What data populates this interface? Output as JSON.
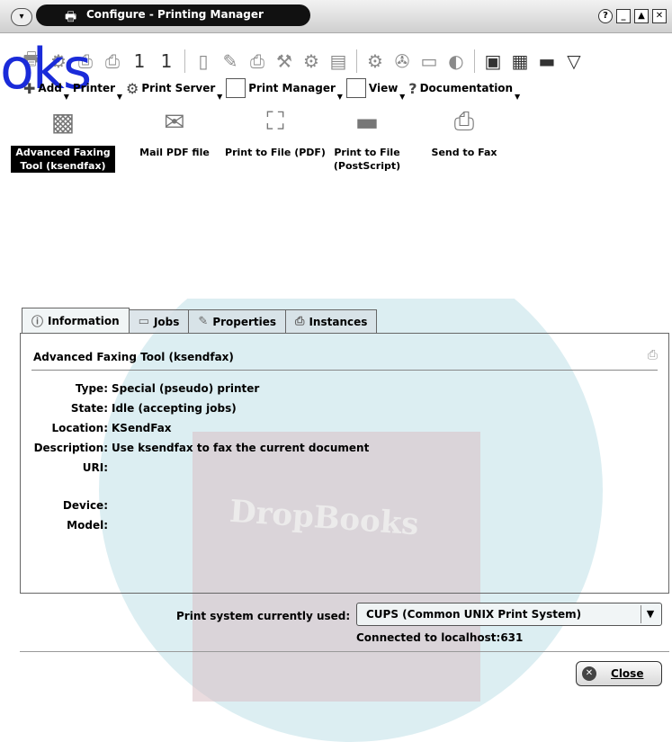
{
  "window": {
    "title": "Configure - Printing Manager",
    "buttons": [
      "?",
      "_",
      "▲",
      "✕"
    ]
  },
  "toolbar_icons": [
    {
      "name": "add-printer-icon",
      "glyph": "🖶",
      "dark": false
    },
    {
      "name": "add-special-icon",
      "glyph": "⚙",
      "dark": false
    },
    {
      "name": "printer-gray-1-icon",
      "glyph": "⎙",
      "dark": false
    },
    {
      "name": "printer-gray-2-icon",
      "glyph": "⎙",
      "dark": false
    },
    {
      "name": "set-default-icon",
      "glyph": "1",
      "dark": true
    },
    {
      "name": "set-user-default-icon",
      "glyph": "1",
      "dark": true
    },
    {
      "name": "test-printer-icon",
      "glyph": "▯",
      "dark": false
    },
    {
      "name": "configure-icon",
      "glyph": "✎",
      "dark": false
    },
    {
      "name": "printer-disabled-icon",
      "glyph": "⎙",
      "dark": false
    },
    {
      "name": "tools-icon",
      "glyph": "⚒",
      "dark": false
    },
    {
      "name": "filter-config-icon",
      "glyph": "⚙",
      "dark": false
    },
    {
      "name": "clipboard-icon",
      "glyph": "▤",
      "dark": false
    },
    {
      "name": "server-config-icon",
      "glyph": "⚙",
      "dark": false
    },
    {
      "name": "server-wizard-icon",
      "glyph": "✇",
      "dark": false
    },
    {
      "name": "server-view-icon",
      "glyph": "▭",
      "dark": false
    },
    {
      "name": "restart-server-icon",
      "glyph": "◐",
      "dark": false
    },
    {
      "name": "view-printers-icon",
      "glyph": "▣",
      "dark": true
    },
    {
      "name": "view-icons-icon",
      "glyph": "▦",
      "dark": true
    },
    {
      "name": "view-toolbar-icon",
      "glyph": "▬",
      "dark": true
    },
    {
      "name": "filter-icon",
      "glyph": "▽",
      "dark": true
    }
  ],
  "menu": [
    {
      "label": "Add",
      "name": "menu-add"
    },
    {
      "label": "Printer",
      "name": "menu-printer"
    },
    {
      "label": "Print Server",
      "name": "menu-print-server"
    },
    {
      "label": "Print Manager",
      "name": "menu-print-manager"
    },
    {
      "label": "View",
      "name": "menu-view"
    },
    {
      "label": "Documentation",
      "name": "menu-documentation"
    }
  ],
  "watermark_oks": "oks",
  "printers": [
    {
      "label": "Advanced Faxing Tool (ksendfax)",
      "icon": "fax-machine-icon",
      "glyph": "▩",
      "selected": true
    },
    {
      "label": "Mail PDF file",
      "icon": "mail-pdf-icon",
      "glyph": "✉",
      "selected": false
    },
    {
      "label": "Print to File (PDF)",
      "icon": "pdf-file-icon",
      "glyph": "⛶",
      "selected": false
    },
    {
      "label": "Print to File (PostScript)",
      "icon": "floppy-disk-icon",
      "glyph": "▬",
      "selected": false
    },
    {
      "label": "Send to Fax",
      "icon": "fax-printer-icon",
      "glyph": "⎙",
      "selected": false
    }
  ],
  "tabs": [
    {
      "label": "Information",
      "icon": "info-icon",
      "glyph": "ⓘ",
      "active": true
    },
    {
      "label": "Jobs",
      "icon": "folder-icon",
      "glyph": "▭",
      "active": false
    },
    {
      "label": "Properties",
      "icon": "wrench-icon",
      "glyph": "✎",
      "active": false
    },
    {
      "label": "Instances",
      "icon": "printer-icon",
      "glyph": "⎙",
      "active": false
    }
  ],
  "info": {
    "title": "Advanced Faxing Tool (ksendfax)",
    "fields": [
      {
        "key": "Type:",
        "value": "Special (pseudo) printer"
      },
      {
        "key": "State:",
        "value": "Idle (accepting jobs)"
      },
      {
        "key": "Location:",
        "value": "KSendFax"
      },
      {
        "key": "Description:",
        "value": "Use ksendfax to fax the current document"
      },
      {
        "key": "URI:",
        "value": ""
      },
      {
        "key": "Device:",
        "value": ""
      },
      {
        "key": "Model:",
        "value": ""
      }
    ]
  },
  "print_system": {
    "label": "Print system currently used:",
    "value": "CUPS (Common UNIX Print System)",
    "status": "Connected to localhost:631"
  },
  "close_label": "Close",
  "watermark_text": "DropBooks"
}
